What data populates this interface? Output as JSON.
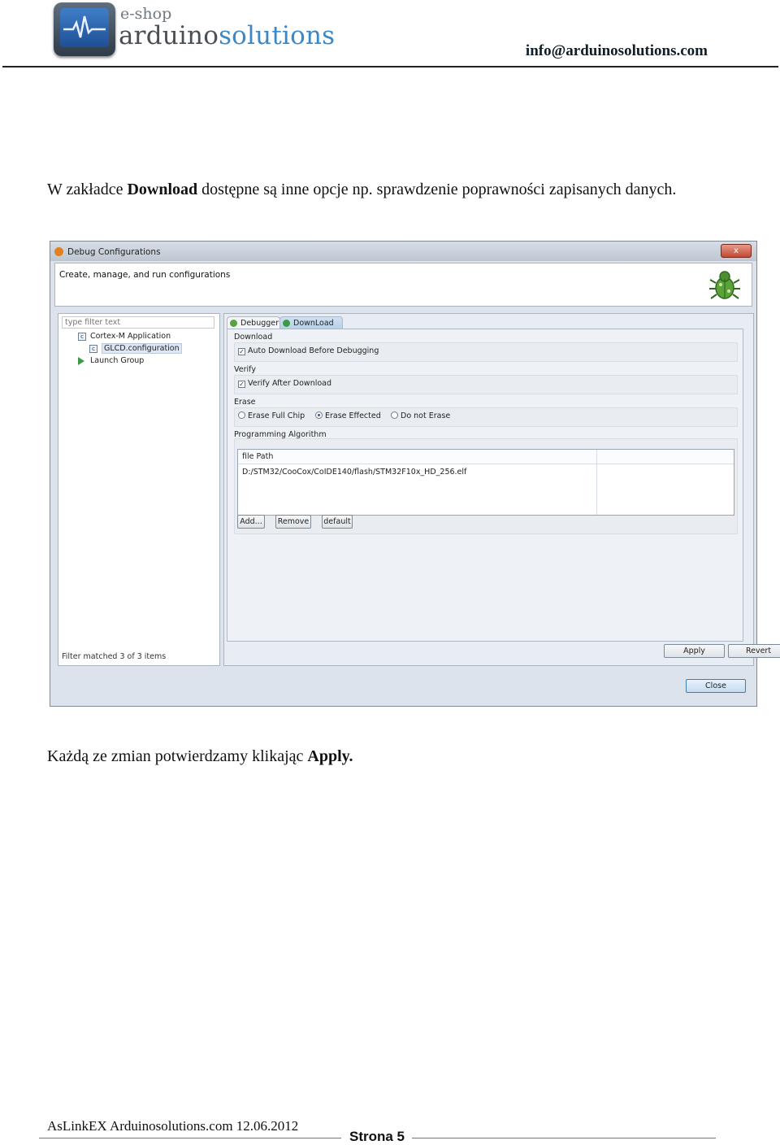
{
  "header": {
    "logo_small": "e-shop",
    "logo_brand_part1": "arduino",
    "logo_brand_part2": "solutions",
    "email": "info@arduinosolutions.com"
  },
  "body": {
    "para1_part1": "W zakładce ",
    "para1_bold": "Download",
    "para1_part2": " dostępne są inne opcje np. sprawdzenie poprawności zapisanych danych.",
    "para2_part1": "Każdą ze zmian potwierdzamy klikając ",
    "para2_bold": "Apply."
  },
  "window": {
    "title": "Debug Configurations",
    "close_label": "x",
    "banner_text": "Create, manage, and run configurations",
    "filter_placeholder": "type filter text",
    "tree": [
      {
        "label": "Cortex-M Application"
      },
      {
        "label": "GLCD.configuration"
      },
      {
        "label": "Launch Group"
      }
    ],
    "filter_status": "Filter matched 3 of 3 items",
    "tabs": [
      {
        "label": "Debugger"
      },
      {
        "label": "DownLoad"
      }
    ],
    "download": {
      "title": "Download",
      "checkbox": "Auto Download Before Debugging",
      "checked": true
    },
    "verify": {
      "title": "Verify",
      "checkbox": "Verify After Download",
      "checked": true
    },
    "erase": {
      "title": "Erase",
      "options": [
        "Erase Full Chip",
        "Erase Effected",
        "Do not Erase"
      ],
      "selected": "Erase Effected"
    },
    "programming_algorithm": {
      "title": "Programming Algorithm",
      "column_header": "file Path",
      "rows": [
        "D:/STM32/CooCox/CoIDE140/flash/STM32F10x_HD_256.elf"
      ]
    },
    "buttons": {
      "add": "Add...",
      "remove": "Remove",
      "default": "default",
      "apply": "Apply",
      "revert": "Revert",
      "close": "Close"
    }
  },
  "footer": {
    "left_text": "AsLinkEX  Arduinosolutions.com 12.06.2012",
    "page_label": "Strona 5"
  },
  "colors": {
    "brand_blue": "#3a88c8",
    "footer_line": "#5b7aa8"
  }
}
